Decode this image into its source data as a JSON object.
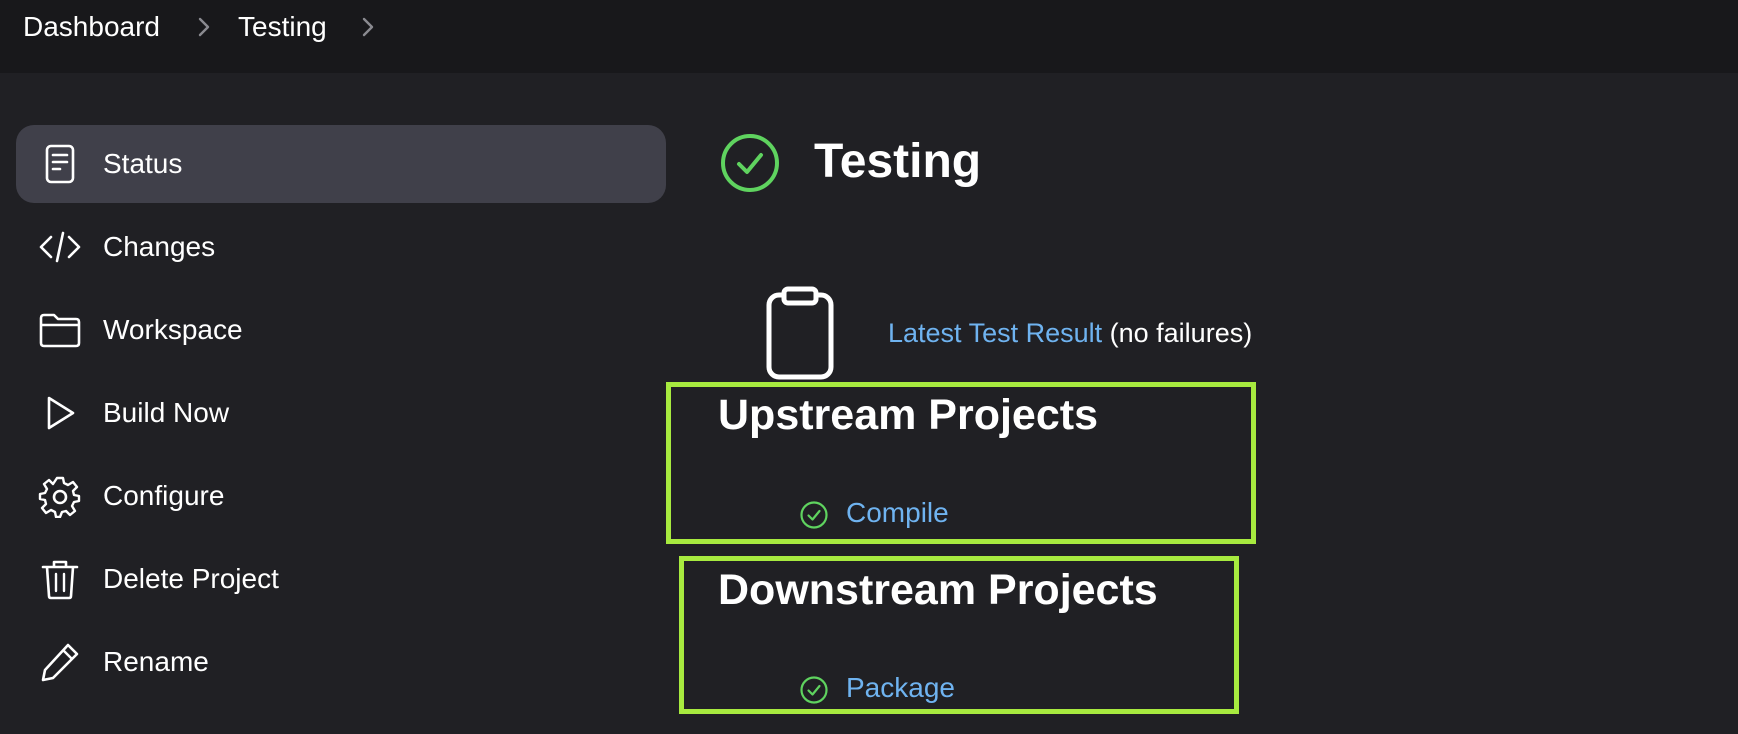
{
  "breadcrumb": {
    "items": [
      "Dashboard",
      "Testing"
    ]
  },
  "sidebar": {
    "items": [
      {
        "label": "Status",
        "icon": "document-icon",
        "active": true
      },
      {
        "label": "Changes",
        "icon": "code-icon",
        "active": false
      },
      {
        "label": "Workspace",
        "icon": "folder-icon",
        "active": false
      },
      {
        "label": "Build Now",
        "icon": "play-icon",
        "active": false
      },
      {
        "label": "Configure",
        "icon": "gear-icon",
        "active": false
      },
      {
        "label": "Delete Project",
        "icon": "trash-icon",
        "active": false
      },
      {
        "label": "Rename",
        "icon": "pencil-icon",
        "active": false
      }
    ]
  },
  "main": {
    "title": "Testing",
    "status": "success",
    "test_result": {
      "link_label": "Latest Test Result",
      "suffix": "(no failures)"
    },
    "upstream": {
      "title": "Upstream Projects",
      "projects": [
        {
          "name": "Compile",
          "status": "success"
        }
      ]
    },
    "downstream": {
      "title": "Downstream Projects",
      "projects": [
        {
          "name": "Package",
          "status": "success"
        }
      ]
    }
  },
  "colors": {
    "background": "#202024",
    "topbar": "#18181b",
    "sidebar_active": "#40404a",
    "link": "#6fb3f0",
    "success": "#5fd35f",
    "highlight": "#a7ea3f"
  }
}
